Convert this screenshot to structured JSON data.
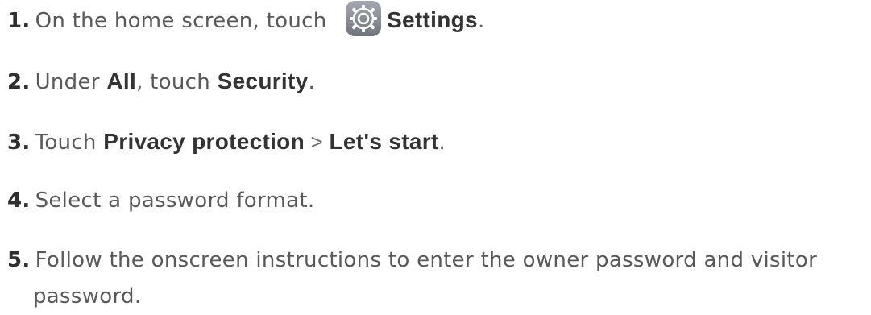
{
  "steps": [
    {
      "number": "1.",
      "text_before": "On the home screen, touch ",
      "icon": "settings-gear-icon",
      "bold": "Settings",
      "text_after": "."
    },
    {
      "number": "2.",
      "text_before": "Under ",
      "bold1": "All",
      "text_mid": ", touch ",
      "bold2": "Security",
      "text_after": "."
    },
    {
      "number": "3.",
      "text_before": "Touch ",
      "bold1": "Privacy protection",
      "separator": " > ",
      "bold2": "Let's start",
      "text_after": "."
    },
    {
      "number": "4.",
      "text": "Select a password format."
    },
    {
      "number": "5.",
      "text_line1": "Follow the onscreen instructions to enter the owner password and visitor",
      "text_line2": "password."
    }
  ],
  "colors": {
    "text": "#595959",
    "bold": "#333333",
    "gear_bg": "#8a8f99"
  }
}
